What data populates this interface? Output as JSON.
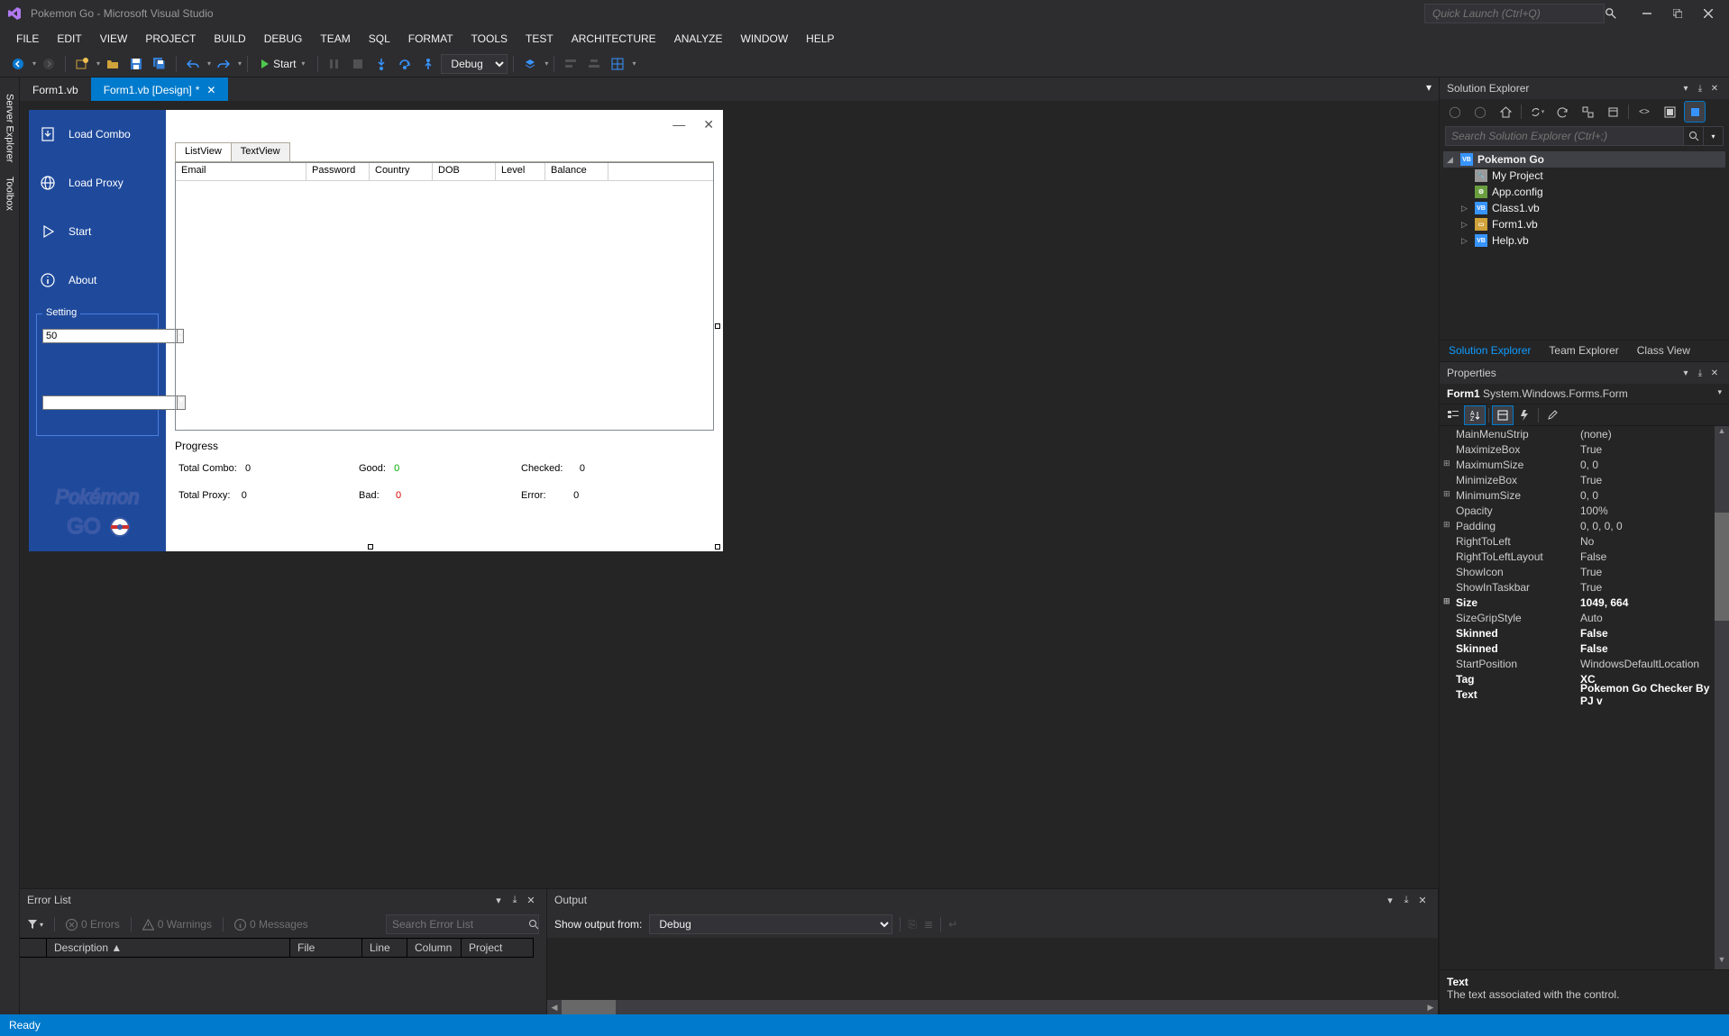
{
  "title": "Pokemon Go - Microsoft Visual Studio",
  "quick_launch_placeholder": "Quick Launch (Ctrl+Q)",
  "menu": [
    "FILE",
    "EDIT",
    "VIEW",
    "PROJECT",
    "BUILD",
    "DEBUG",
    "TEAM",
    "SQL",
    "FORMAT",
    "TOOLS",
    "TEST",
    "ARCHITECTURE",
    "ANALYZE",
    "WINDOW",
    "HELP"
  ],
  "toolbar": {
    "start_label": "Start",
    "config_label": "Debug"
  },
  "left_tabs": [
    "Server Explorer",
    "Toolbox"
  ],
  "doc_tabs": [
    {
      "label": "Form1.vb",
      "active": false
    },
    {
      "label": "Form1.vb [Design]",
      "active": true,
      "dirty": true
    }
  ],
  "form": {
    "sidebar_items": [
      {
        "label": "Load Combo",
        "icon": "download-icon"
      },
      {
        "label": "Load Proxy",
        "icon": "globe-icon"
      },
      {
        "label": "Start",
        "icon": "play-icon"
      },
      {
        "label": "About",
        "icon": "info-icon"
      }
    ],
    "setting_legend": "Setting",
    "setting_value": "50",
    "content_tabs": [
      "ListView",
      "TextView"
    ],
    "lv_columns": [
      "Email",
      "Password",
      "Country",
      "DOB",
      "Level",
      "Balance"
    ],
    "progress_title": "Progress",
    "progress": {
      "total_combo_label": "Total Combo:",
      "total_combo": "0",
      "total_proxy_label": "Total Proxy:",
      "total_proxy": "0",
      "good_label": "Good:",
      "good": "0",
      "bad_label": "Bad:",
      "bad": "0",
      "checked_label": "Checked:",
      "checked": "0",
      "error_label": "Error:",
      "error": "0"
    }
  },
  "solution_explorer": {
    "title": "Solution Explorer",
    "search_placeholder": "Search Solution Explorer (Ctrl+;)",
    "root": "Pokemon Go",
    "items": [
      "My Project",
      "App.config",
      "Class1.vb",
      "Form1.vb",
      "Help.vb"
    ],
    "tabs": [
      "Solution Explorer",
      "Team Explorer",
      "Class View"
    ]
  },
  "properties": {
    "title": "Properties",
    "object_name": "Form1",
    "object_type": "System.Windows.Forms.Form",
    "rows": [
      {
        "name": "MainMenuStrip",
        "value": "(none)"
      },
      {
        "name": "MaximizeBox",
        "value": "True"
      },
      {
        "name": "MaximumSize",
        "value": "0, 0",
        "expandable": true
      },
      {
        "name": "MinimizeBox",
        "value": "True"
      },
      {
        "name": "MinimumSize",
        "value": "0, 0",
        "expandable": true
      },
      {
        "name": "Opacity",
        "value": "100%"
      },
      {
        "name": "Padding",
        "value": "0, 0, 0, 0",
        "expandable": true
      },
      {
        "name": "RightToLeft",
        "value": "No"
      },
      {
        "name": "RightToLeftLayout",
        "value": "False"
      },
      {
        "name": "ShowIcon",
        "value": "True"
      },
      {
        "name": "ShowInTaskbar",
        "value": "True"
      },
      {
        "name": "Size",
        "value": "1049, 664",
        "bold": true,
        "expandable": true
      },
      {
        "name": "SizeGripStyle",
        "value": "Auto"
      },
      {
        "name": "Skinned",
        "value": "False",
        "bold": true
      },
      {
        "name": "Skinned",
        "value": "False",
        "bold": true
      },
      {
        "name": "StartPosition",
        "value": "WindowsDefaultLocation"
      },
      {
        "name": "Tag",
        "value": "XC",
        "bold": true
      },
      {
        "name": "Text",
        "value": "Pokemon Go Checker By PJ v",
        "bold": true
      }
    ],
    "desc_name": "Text",
    "desc_text": "The text associated with the control."
  },
  "error_list": {
    "title": "Error List",
    "errors_label": "0 Errors",
    "warnings_label": "0 Warnings",
    "messages_label": "0 Messages",
    "search_placeholder": "Search Error List",
    "columns": [
      "",
      "Description",
      "File",
      "Line",
      "Column",
      "Project"
    ]
  },
  "output": {
    "title": "Output",
    "show_from_label": "Show output from:",
    "show_from_value": "Debug"
  },
  "statusbar": {
    "ready": "Ready"
  }
}
